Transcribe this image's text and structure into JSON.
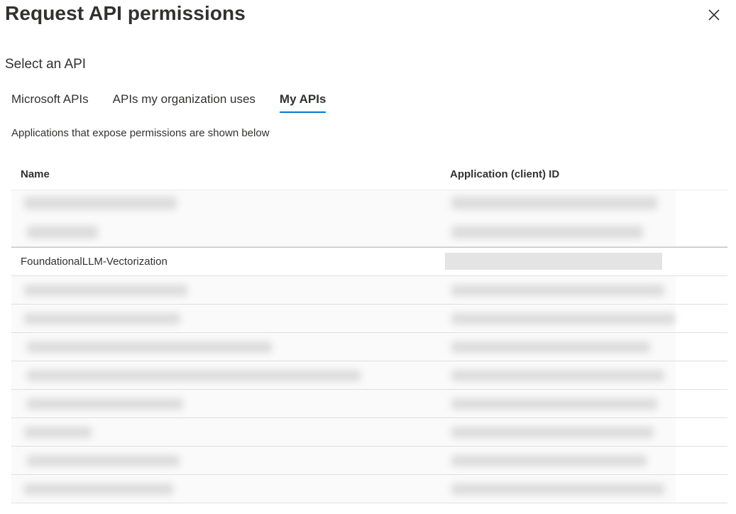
{
  "dialog": {
    "title": "Request API permissions",
    "close_label": "Close"
  },
  "section": {
    "subtitle": "Select an API"
  },
  "tabs": [
    {
      "label": "Microsoft APIs",
      "active": false
    },
    {
      "label": "APIs my organization uses",
      "active": false
    },
    {
      "label": "My APIs",
      "active": true
    }
  ],
  "hint": "Applications that expose permissions are shown below",
  "table": {
    "columns": [
      "Name",
      "Application (client) ID"
    ],
    "visible_row": {
      "name": "FoundationalLLM-Vectorization"
    }
  },
  "colors": {
    "accent": "#0078d4",
    "text": "#323130",
    "divider": "#e1dfdd"
  }
}
